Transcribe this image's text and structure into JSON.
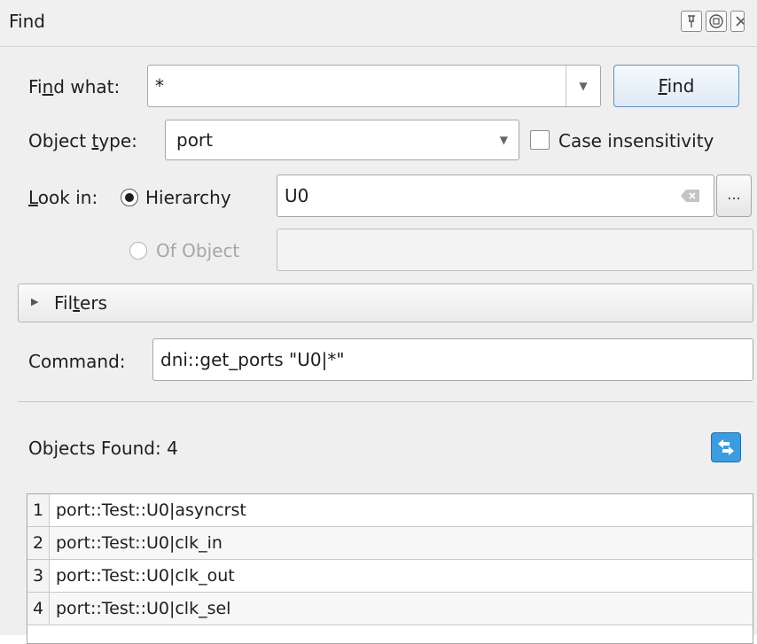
{
  "window": {
    "title": "Find",
    "pin_icon": "pin-icon",
    "float_icon": "float-icon",
    "close_icon": "close-icon"
  },
  "find_what": {
    "label_pre": "Fi",
    "label_u": "n",
    "label_post": "d what:",
    "value": "*"
  },
  "find_button": {
    "pre": "",
    "u": "F",
    "post": "ind"
  },
  "object_type": {
    "label_pre": "Object ",
    "label_u": "t",
    "label_post": "ype:",
    "value": "port"
  },
  "case_insensitivity": {
    "label": "Case insensitivity",
    "checked": false
  },
  "look_in": {
    "label_u": "L",
    "label_post": "ook in:",
    "hierarchy_label": "Hierarchy",
    "hierarchy_value": "U0",
    "browse_label": "...",
    "of_object_label": "Of Object",
    "of_object_value": ""
  },
  "filters": {
    "pre": "Fil",
    "u": "t",
    "post": "ers"
  },
  "command": {
    "label": "Command:",
    "value": "dni::get_ports \"U0|*\""
  },
  "results": {
    "summary": "Objects Found: 4",
    "rows": [
      {
        "num": "1",
        "text": "port::Test::U0|asyncrst"
      },
      {
        "num": "2",
        "text": "port::Test::U0|clk_in"
      },
      {
        "num": "3",
        "text": "port::Test::U0|clk_out"
      },
      {
        "num": "4",
        "text": "port::Test::U0|clk_sel"
      }
    ]
  },
  "colors": {
    "accent": "#3b9de0",
    "panel": "#efefef",
    "button_border": "#5e8fbf"
  }
}
